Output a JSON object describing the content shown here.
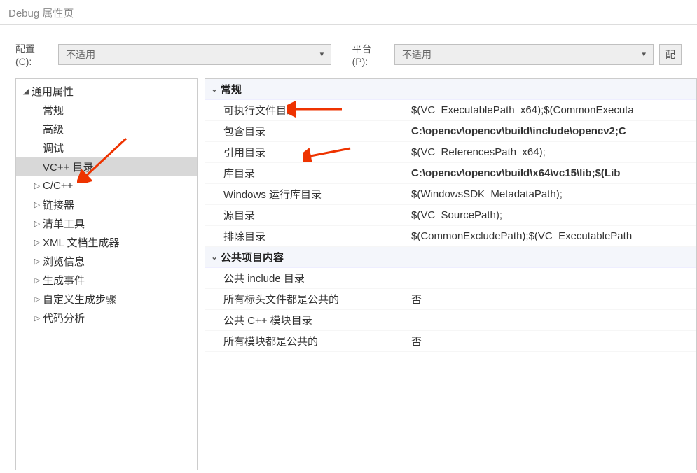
{
  "window": {
    "title": "Debug 属性页"
  },
  "toolbar": {
    "config_label": "配置(C):",
    "config_value": "不适用",
    "platform_label": "平台(P):",
    "platform_value": "不适用",
    "mgr_button": "配"
  },
  "sidebar": {
    "root": "通用属性",
    "items": [
      {
        "label": "常规"
      },
      {
        "label": "高级"
      },
      {
        "label": "调试"
      },
      {
        "label": "VC++ 目录",
        "selected": true
      },
      {
        "label": "C/C++",
        "expandable": true
      },
      {
        "label": "链接器",
        "expandable": true
      },
      {
        "label": "清单工具",
        "expandable": true
      },
      {
        "label": "XML 文档生成器",
        "expandable": true
      },
      {
        "label": "浏览信息",
        "expandable": true
      },
      {
        "label": "生成事件",
        "expandable": true
      },
      {
        "label": "自定义生成步骤",
        "expandable": true
      },
      {
        "label": "代码分析",
        "expandable": true
      }
    ]
  },
  "propgrid": {
    "categories": [
      {
        "name": "常规",
        "rows": [
          {
            "key": "可执行文件目录",
            "value": "$(VC_ExecutablePath_x64);$(CommonExecuta"
          },
          {
            "key": "包含目录",
            "value": "C:\\opencv\\opencv\\build\\include\\opencv2;C",
            "bold": true
          },
          {
            "key": "引用目录",
            "value": "$(VC_ReferencesPath_x64);"
          },
          {
            "key": "库目录",
            "value": "C:\\opencv\\opencv\\build\\x64\\vc15\\lib;$(Lib",
            "bold": true
          },
          {
            "key": "Windows 运行库目录",
            "value": "$(WindowsSDK_MetadataPath);"
          },
          {
            "key": "源目录",
            "value": "$(VC_SourcePath);"
          },
          {
            "key": "排除目录",
            "value": "$(CommonExcludePath);$(VC_ExecutablePath"
          }
        ]
      },
      {
        "name": "公共项目内容",
        "rows": [
          {
            "key": "公共 include 目录",
            "value": ""
          },
          {
            "key": "所有标头文件都是公共的",
            "value": "否"
          },
          {
            "key": "公共 C++ 模块目录",
            "value": ""
          },
          {
            "key": "所有模块都是公共的",
            "value": "否"
          }
        ]
      }
    ]
  }
}
